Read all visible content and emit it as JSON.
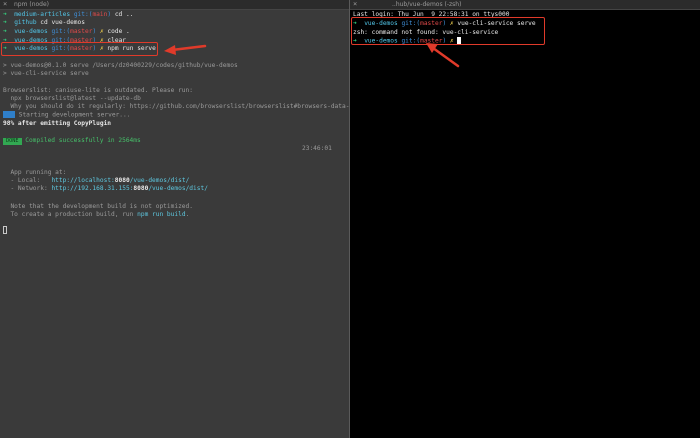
{
  "left_tab": {
    "close_icon": "×",
    "title": "npm (node)"
  },
  "right_tab": {
    "close_icon": "×",
    "title": "..hub/vue-demos (-zsh)"
  },
  "prompt_arrow": "➜",
  "left": {
    "l1": {
      "dir": "medium-articles",
      "git": "git:(",
      "branch": "main",
      "close": ")",
      "cmd": "cd .."
    },
    "l2": {
      "dir": "github",
      "cmd": "cd vue-demos"
    },
    "l3": {
      "dir": "vue-demos",
      "git": "git:(",
      "branch": "master",
      "close": ")",
      "dirty": "✗",
      "cmd": "code ."
    },
    "l4": {
      "dir": "vue-demos",
      "git": "git:(",
      "branch": "master",
      "close": ")",
      "dirty": "✗",
      "cmd": "clear"
    },
    "l5": {
      "dir": "vue-demos",
      "git": "git:(",
      "branch": "master",
      "close": ")",
      "dirty": "✗",
      "cmd": "npm run serve"
    },
    "npm_line1": "> vue-demos@0.1.0 serve /Users/dz0400229/codes/github/vue-demos",
    "npm_line2": "> vue-cli-service serve",
    "browserslist1": "Browserslist: caniuse-lite is outdated. Please run:",
    "browserslist2": "  npx browserslist@latest --update-db",
    "browserslist3": "  Why you should do it regularly: https://github.com/browserslist/browserslist#browsers-data-updating",
    "starting": " Starting development server...",
    "progress": "98% after emitting CopyPlugin",
    "done_badge": "DONE",
    "compiled": "Compiled successfully in 2564ms",
    "time": "23:46:01",
    "app_running": "App running at:",
    "local_label": "- Local:   ",
    "local_prefix": "http://localhost:",
    "local_port": "8080",
    "local_suffix": "/vue-demos/dist/",
    "network_label": "- Network: ",
    "network_prefix": "http://192.168.31.155:",
    "network_port": "8080",
    "network_suffix": "/vue-demos/dist/",
    "note1": "Note that the development build is not optimized.",
    "note2_prefix": "To create a production build, run ",
    "note2_cmd": "npm run build",
    "note2_suffix": "."
  },
  "right": {
    "last_login": "Last login: Thu Jun  9 22:58:31 on ttys000",
    "r2": {
      "dir": "vue-demos",
      "git": "git:(",
      "branch": "master",
      "close": ")",
      "dirty": "✗",
      "cmd": "vue-cli-service serve"
    },
    "error": "zsh: command not found: vue-cli-service",
    "r4": {
      "dir": "vue-demos",
      "git": "git:(",
      "branch": "master",
      "close": ")",
      "dirty": "✗"
    }
  },
  "colors": {
    "highlight": "#e03a2a",
    "prompt_arrow": "#35d07f",
    "branch": "#e04a4a"
  }
}
